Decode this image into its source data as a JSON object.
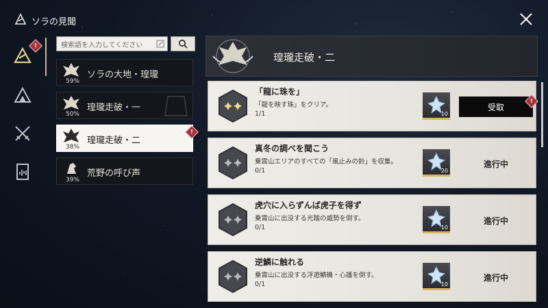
{
  "window": {
    "title": "ソラの見聞",
    "close_icon": "close-x-icon"
  },
  "rail": {
    "items": [
      {
        "name": "journal",
        "icon": "emblem-icon",
        "active": true,
        "alert": "!"
      },
      {
        "name": "mountain",
        "icon": "peak-icon",
        "active": false
      },
      {
        "name": "combat",
        "icon": "crossed-blades-icon",
        "active": false
      },
      {
        "name": "records",
        "icon": "audio-book-icon",
        "active": false
      }
    ]
  },
  "search": {
    "placeholder": "検索語を入力してください",
    "edit_icon": "edit-icon",
    "button_icon": "search-icon"
  },
  "categories": [
    {
      "label": "ソラの大地・瑝瓏",
      "percent": "59%",
      "selected": false
    },
    {
      "label": "瑝瓏走破・一",
      "percent": "50%",
      "selected": false
    },
    {
      "label": "瑝瓏走破・二",
      "percent": "38%",
      "selected": true,
      "alert": "!"
    },
    {
      "label": "荒野の呼び声",
      "percent": "39%",
      "selected": false
    }
  ],
  "header": {
    "title": "瑝瓏走破・二"
  },
  "quests": [
    {
      "title": "「龍に珠を」",
      "description": "「龍を映す珠」をクリア。",
      "progress": "1/1",
      "reward_count": "10",
      "action": "受取",
      "claimable": true,
      "alert": "!"
    },
    {
      "title": "真冬の調べを聞こう",
      "description": "乗霄山エリアのすべての「風止みの鈴」を収集。",
      "progress": "0/1",
      "reward_count": "20",
      "action": "進行中",
      "claimable": false
    },
    {
      "title": "虎穴に入らずんば虎子を得ず",
      "description": "乗霄山に出没する光踏の威勢を倒す。",
      "progress": "0/1",
      "reward_count": "10",
      "action": "進行中",
      "claimable": false
    },
    {
      "title": "逆鱗に触れる",
      "description": "乗霄山に出没する浮遊鱗機・心護を倒す。",
      "progress": "0/1",
      "reward_count": "10",
      "action": "進行中",
      "claimable": false
    }
  ],
  "colors": {
    "accent_gold": "#c9b98a",
    "alert_red": "#a8323a",
    "claim_bg": "#0b0b0c"
  }
}
